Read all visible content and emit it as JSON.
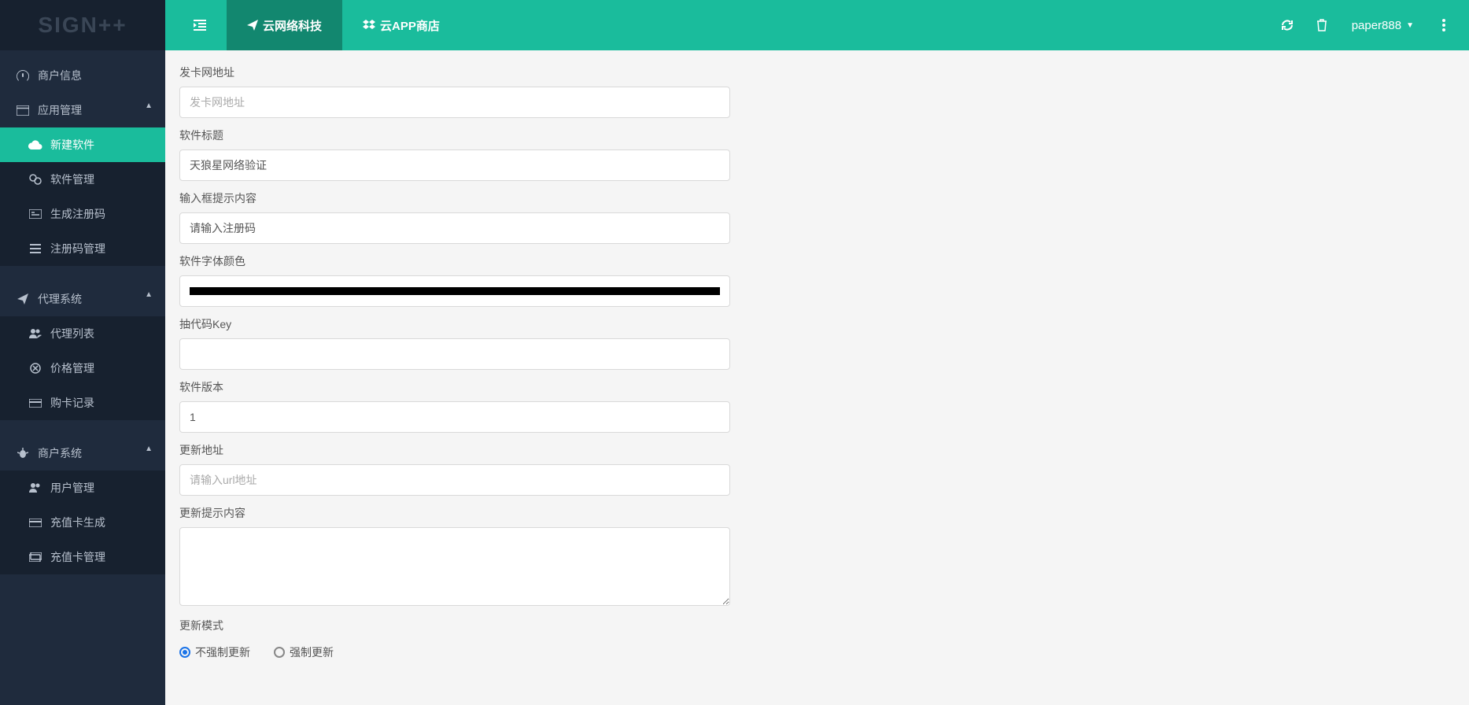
{
  "logo": "SIGN++",
  "topbar": {
    "item1": "云网络科技",
    "item2": "云APP商店",
    "user": "paper888"
  },
  "sidebar": {
    "merchant_info": "商户信息",
    "app_manage": "应用管理",
    "new_software": "新建软件",
    "software_manage": "软件管理",
    "gen_regcode": "生成注册码",
    "regcode_manage": "注册码管理",
    "agent_system": "代理系统",
    "agent_list": "代理列表",
    "price_manage": "价格管理",
    "purchase_record": "购卡记录",
    "merchant_system": "商户系统",
    "user_manage": "用户管理",
    "recharge_gen": "充值卡生成",
    "recharge_manage": "充值卡管理"
  },
  "form": {
    "card_url_label": "发卡网地址",
    "card_url_placeholder": "发卡网地址",
    "card_url_value": "",
    "title_label": "软件标题",
    "title_value": "天狼星网络验证",
    "hint_label": "输入框提示内容",
    "hint_value": "请输入注册码",
    "color_label": "软件字体颜色",
    "color_value": "#000000",
    "key_label": "抽代码Key",
    "key_value": "",
    "version_label": "软件版本",
    "version_value": "1",
    "update_url_label": "更新地址",
    "update_url_placeholder": "请输入url地址",
    "update_url_value": "",
    "update_msg_label": "更新提示内容",
    "update_msg_value": "",
    "update_mode_label": "更新模式",
    "radio_no_force": "不强制更新",
    "radio_force": "强制更新",
    "radio_selected": "no_force"
  }
}
